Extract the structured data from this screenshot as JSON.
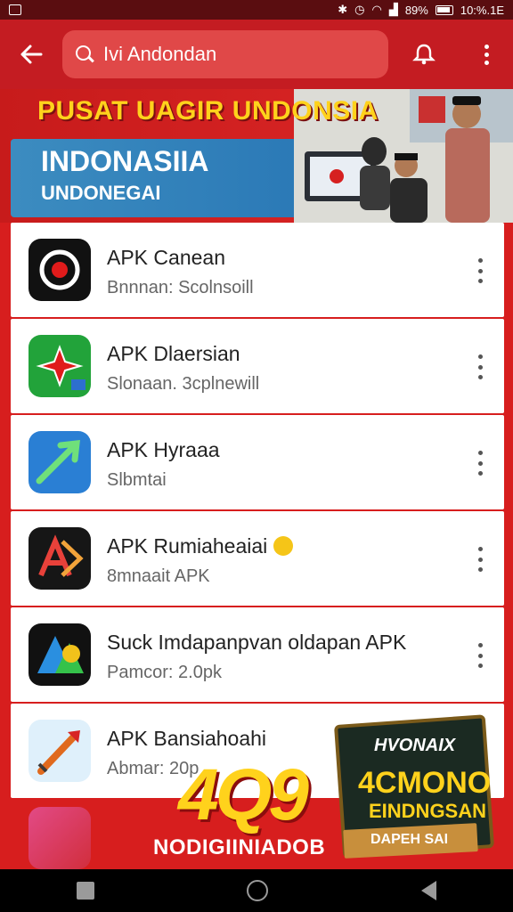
{
  "status_bar": {
    "time": "10:%.1E",
    "battery": "89%"
  },
  "app_bar": {
    "search_query": "Ivi Andondan"
  },
  "banner": {
    "headline": "PUSAT UAGIR UNDONSIA",
    "title": "INDONASIIA",
    "subtitle": "UNDONEGAI"
  },
  "apps": [
    {
      "title": "APK Canean",
      "subtitle": "Bnnnan: Scolnsoill"
    },
    {
      "title": "APK Dlaersian",
      "subtitle": "Slonaan. 3cplnewill"
    },
    {
      "title": "APK Hyraaa",
      "subtitle": "Slbmtai"
    },
    {
      "title": "APK Rumiaheaiai",
      "subtitle": "8mnaait APK"
    },
    {
      "title": "Suck Imdapanpvan oldapan APK",
      "subtitle": "Pamcor: 2.0pk"
    },
    {
      "title": "APK Bansiahoahi",
      "subtitle": "Abmar: 20p"
    }
  ],
  "promo": {
    "number": "4Q9",
    "footer": "NODIGIINIADOB",
    "badge_line1": "HVONAIX",
    "badge_line2": "4CMONO",
    "badge_line3": "EINDNGSAN",
    "badge_ribbon": "DAPEH SAI"
  },
  "colors": {
    "primary": "#c41c22",
    "banner_blue": "#2775b4",
    "accent_yellow": "#ffd21c"
  }
}
